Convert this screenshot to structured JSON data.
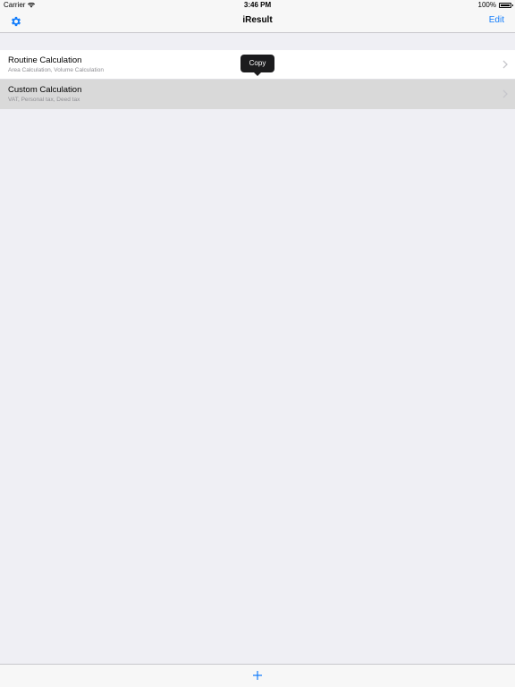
{
  "status_bar": {
    "carrier": "Carrier",
    "time": "3:46 PM",
    "battery": "100%"
  },
  "nav": {
    "title": "iResult",
    "edit_label": "Edit",
    "left_icon": "gear-icon"
  },
  "list": {
    "items": [
      {
        "title": "Routine Calculation",
        "subtitle": "Area Calculation, Volume Calculation"
      },
      {
        "title": "Custom Calculation",
        "subtitle": "VAT, Personal tax, Deed tax"
      }
    ]
  },
  "tooltip": {
    "label": "Copy"
  },
  "toolbar": {
    "add_icon": "plus-icon"
  },
  "colors": {
    "accent": "#157efb",
    "background": "#efeff4",
    "selected_row": "#d9d9d9"
  }
}
